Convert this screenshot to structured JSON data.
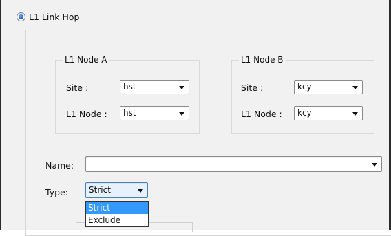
{
  "link_hop": {
    "label": "L1 Link Hop",
    "selected": true
  },
  "node_a": {
    "title": "L1 Node A",
    "site_label": "Site :",
    "site_value": "hst",
    "node_label": "L1 Node :",
    "node_value": "hst"
  },
  "node_b": {
    "title": "L1 Node B",
    "site_label": "Site :",
    "site_value": "kcy",
    "node_label": "L1 Node :",
    "node_value": "kcy"
  },
  "name": {
    "label": "Name:",
    "value": ""
  },
  "type": {
    "label": "Type:",
    "value": "Strict",
    "options": [
      "Strict",
      "Exclude"
    ],
    "highlighted_option": "Strict"
  },
  "colors": {
    "highlight": "#3399ff",
    "panel_bg": "#f1f1f1"
  },
  "icons": {
    "radio": "radio-selected-icon",
    "dropdown": "chevron-down-icon"
  }
}
